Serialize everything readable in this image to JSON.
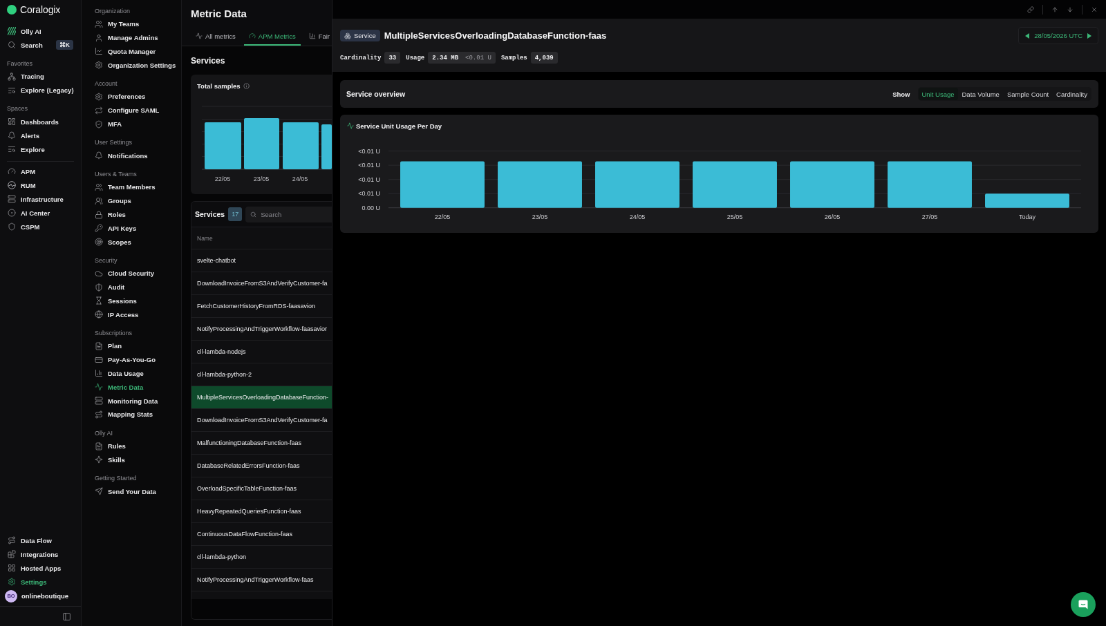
{
  "primary_nav": {
    "brand": "Coralogix",
    "groups": [
      {
        "items": [
          {
            "label": "Olly AI",
            "selected": false
          },
          {
            "label": "Search",
            "shortcut": "⌘K",
            "selected": false
          }
        ]
      },
      {
        "title": "Favorites",
        "items": [
          {
            "label": "Tracing",
            "selected": false
          },
          {
            "label": "Explore (Legacy)",
            "selected": false
          }
        ]
      },
      {
        "title": "Spaces",
        "items": [
          {
            "label": "Dashboards",
            "selected": false
          },
          {
            "label": "Alerts",
            "selected": false
          },
          {
            "label": "Explore",
            "selected": false
          }
        ]
      },
      {
        "items": [
          {
            "label": "APM",
            "selected": false
          },
          {
            "label": "RUM",
            "selected": false
          },
          {
            "label": "Infrastructure",
            "selected": false
          },
          {
            "label": "AI Center",
            "selected": false
          },
          {
            "label": "CSPM",
            "selected": false
          }
        ]
      }
    ],
    "bottom_items": [
      {
        "label": "Data Flow",
        "selected": false
      },
      {
        "label": "Integrations",
        "selected": false
      },
      {
        "label": "Hosted Apps",
        "selected": false
      },
      {
        "label": "Settings",
        "selected": true
      }
    ],
    "user": {
      "initials": "BO",
      "name": "onlineboutique"
    }
  },
  "settings_nav": {
    "sections": [
      {
        "title": "Organization",
        "items": [
          {
            "label": "My Teams",
            "selected": false
          },
          {
            "label": "Manage Admins",
            "selected": false
          },
          {
            "label": "Quota Manager",
            "selected": false
          },
          {
            "label": "Organization Settings",
            "selected": false
          }
        ]
      },
      {
        "title": "Account",
        "items": [
          {
            "label": "Preferences",
            "selected": false
          },
          {
            "label": "Configure SAML",
            "selected": false
          },
          {
            "label": "MFA",
            "selected": false
          }
        ]
      },
      {
        "title": "User Settings",
        "items": [
          {
            "label": "Notifications",
            "selected": false
          }
        ]
      },
      {
        "title": "Users & Teams",
        "items": [
          {
            "label": "Team Members",
            "selected": false
          },
          {
            "label": "Groups",
            "selected": false
          },
          {
            "label": "Roles",
            "selected": false
          },
          {
            "label": "API Keys",
            "selected": false
          },
          {
            "label": "Scopes",
            "selected": false
          }
        ]
      },
      {
        "title": "Security",
        "items": [
          {
            "label": "Cloud Security",
            "selected": false
          },
          {
            "label": "Audit",
            "selected": false
          },
          {
            "label": "Sessions",
            "selected": false
          },
          {
            "label": "IP Access",
            "selected": false
          }
        ]
      },
      {
        "title": "Subscriptions",
        "items": [
          {
            "label": "Plan",
            "selected": false
          },
          {
            "label": "Pay-As-You-Go",
            "selected": false
          },
          {
            "label": "Data Usage",
            "selected": false
          },
          {
            "label": "Metric Data",
            "selected": true
          },
          {
            "label": "Monitoring Data",
            "selected": false
          },
          {
            "label": "Mapping Stats",
            "selected": false
          }
        ]
      },
      {
        "title": "Olly AI",
        "items": [
          {
            "label": "Rules",
            "selected": false
          },
          {
            "label": "Skills",
            "selected": false
          }
        ]
      },
      {
        "title": "Getting Started",
        "items": [
          {
            "label": "Send Your Data",
            "selected": false
          }
        ]
      }
    ]
  },
  "page": {
    "title": "Metric Data",
    "tabs": [
      {
        "label": "All metrics",
        "selected": false
      },
      {
        "label": "APM Metrics",
        "selected": true
      },
      {
        "label": "Fair",
        "selected": false
      }
    ],
    "section_title": "Services",
    "total_samples": {
      "title": "Total samples",
      "x_labels": [
        "22/05",
        "23/05",
        "24/05"
      ]
    },
    "services_table": {
      "title": "Services",
      "count": "17",
      "search": {
        "placeholder": "Search"
      },
      "columns": [
        "Name"
      ],
      "rows": [
        {
          "name": "svelte-chatbot",
          "selected": false
        },
        {
          "name": "DownloadInvoiceFromS3AndVerifyCustomer-fa",
          "selected": false
        },
        {
          "name": "FetchCustomerHistoryFromRDS-faasavion",
          "selected": false
        },
        {
          "name": "NotifyProcessingAndTriggerWorkflow-faasavior",
          "selected": false
        },
        {
          "name": "cll-lambda-nodejs",
          "selected": false
        },
        {
          "name": "cll-lambda-python-2",
          "selected": false
        },
        {
          "name": "MultipleServicesOverloadingDatabaseFunction-",
          "selected": true
        },
        {
          "name": "DownloadInvoiceFromS3AndVerifyCustomer-fa",
          "selected": false
        },
        {
          "name": "MalfunctioningDatabaseFunction-faas",
          "selected": false
        },
        {
          "name": "DatabaseRelatedErrorsFunction-faas",
          "selected": false
        },
        {
          "name": "OverloadSpecificTableFunction-faas",
          "selected": false
        },
        {
          "name": "HeavyRepeatedQueriesFunction-faas",
          "selected": false
        },
        {
          "name": "ContinuousDataFlowFunction-faas",
          "selected": false
        },
        {
          "name": "cll-lambda-python",
          "selected": false
        },
        {
          "name": "NotifyProcessingAndTriggerWorkflow-faas",
          "selected": false
        }
      ]
    }
  },
  "detail_drawer": {
    "badge": "Service",
    "title": "MultipleServicesOverloadingDatabaseFunction-faas",
    "date": "28/05/2026 UTC",
    "stats": [
      {
        "label": "Cardinality",
        "value": "33"
      },
      {
        "label": "Usage",
        "value": "2.34 MB",
        "secondary": "<0.01 U"
      },
      {
        "label": "Samples",
        "value": "4,039"
      }
    ],
    "overview": {
      "title": "Service overview",
      "show_label": "Show",
      "options": [
        {
          "label": "Unit Usage",
          "selected": true
        },
        {
          "label": "Data Volume",
          "selected": false
        },
        {
          "label": "Sample Count",
          "selected": false
        },
        {
          "label": "Cardinality",
          "selected": false
        }
      ]
    },
    "usage_chart": {
      "title": "Service Unit Usage Per Day",
      "y_labels": [
        "<0.01 U",
        "<0.01 U",
        "<0.01 U",
        "<0.01 U",
        "0.00 U"
      ],
      "x_labels": [
        "22/05",
        "23/05",
        "24/05",
        "25/05",
        "26/05",
        "27/05",
        "Today"
      ]
    }
  }
}
